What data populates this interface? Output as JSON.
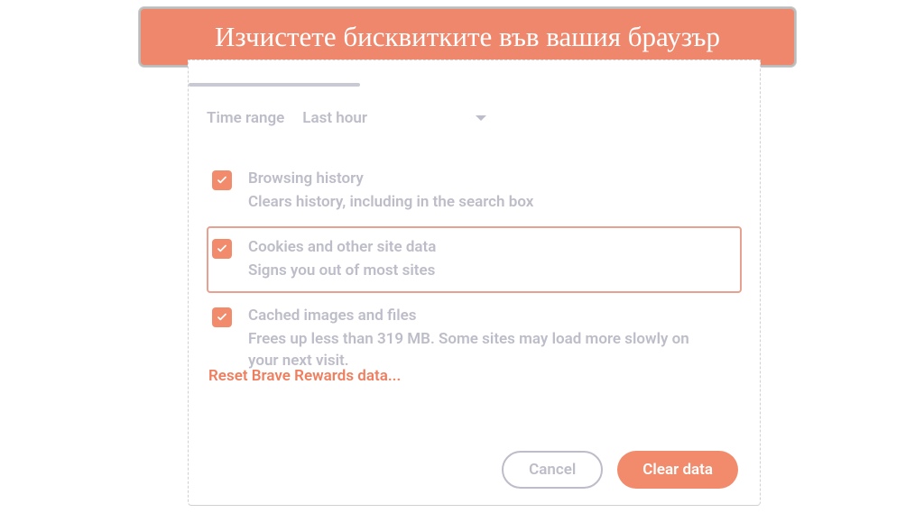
{
  "banner": {
    "title": "Изчистете бисквитките във вашия браузър"
  },
  "timeRange": {
    "label": "Time range",
    "value": "Last hour"
  },
  "options": [
    {
      "title": "Browsing history",
      "desc": "Clears history, including in the search box",
      "checked": true,
      "highlight": false
    },
    {
      "title": "Cookies and other site data",
      "desc": "Signs you out of most sites",
      "checked": true,
      "highlight": true
    },
    {
      "title": "Cached images and files",
      "desc": "Frees up less than 319 MB. Some sites may load more slowly on your next visit.",
      "checked": true,
      "highlight": false
    }
  ],
  "resetLink": "Reset Brave Rewards data...",
  "buttons": {
    "cancel": "Cancel",
    "clear": "Clear data"
  }
}
